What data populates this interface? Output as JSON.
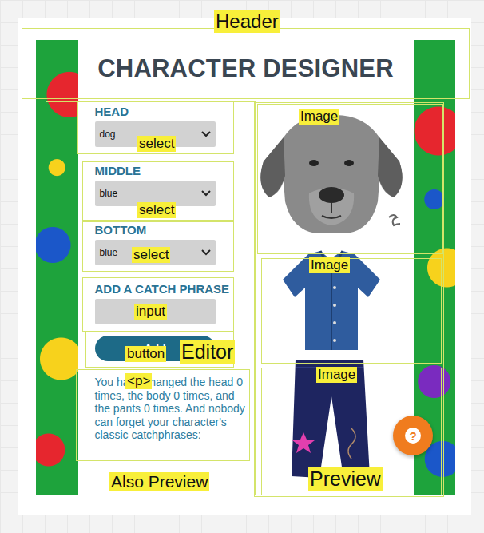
{
  "header": {
    "title": "CHARACTER DESIGNER"
  },
  "editor": {
    "fields": [
      {
        "label": "HEAD",
        "kind": "select",
        "value": "dog"
      },
      {
        "label": "MIDDLE",
        "kind": "select",
        "value": "blue"
      },
      {
        "label": "BOTTOM",
        "kind": "select",
        "value": "blue"
      },
      {
        "label": "ADD A CATCH PHRASE",
        "kind": "input",
        "value": ""
      }
    ],
    "button": {
      "label": "Add"
    },
    "summary": "You have changed the head 0 times, the body 0 times, and the pants 0 times. And nobody can forget your character's classic catchphrases:"
  },
  "help_button": {
    "icon": "?"
  },
  "annotations": [
    {
      "label": "Header"
    },
    {
      "label": "select"
    },
    {
      "label": "select"
    },
    {
      "label": "select"
    },
    {
      "label": "input"
    },
    {
      "label": "button"
    },
    {
      "label": "Editor"
    },
    {
      "label": "<p>"
    },
    {
      "label": "Also Preview"
    },
    {
      "label": "Image"
    },
    {
      "label": "Image"
    },
    {
      "label": "Image"
    },
    {
      "label": "Preview"
    }
  ]
}
